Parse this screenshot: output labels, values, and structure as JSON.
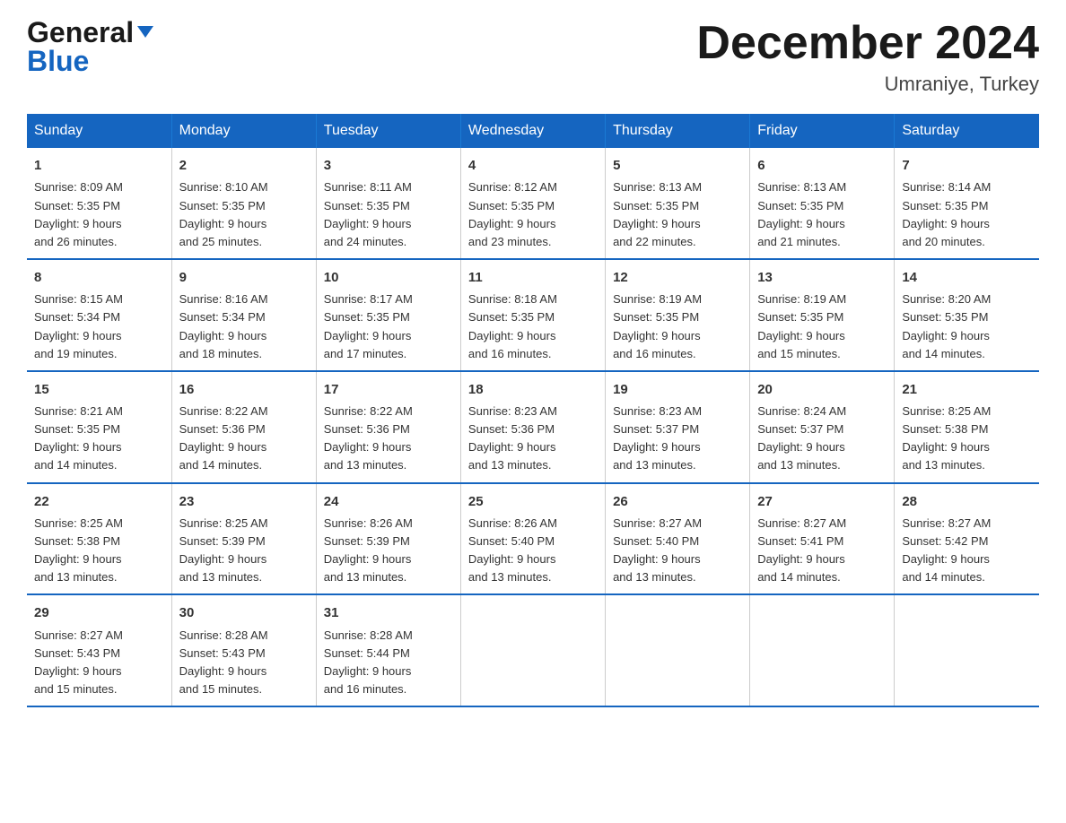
{
  "header": {
    "logo_line1": "General",
    "logo_line2": "Blue",
    "month_title": "December 2024",
    "location": "Umraniye, Turkey"
  },
  "days_of_week": [
    "Sunday",
    "Monday",
    "Tuesday",
    "Wednesday",
    "Thursday",
    "Friday",
    "Saturday"
  ],
  "weeks": [
    [
      {
        "day": 1,
        "sunrise": "8:09 AM",
        "sunset": "5:35 PM",
        "daylight": "9 hours and 26 minutes."
      },
      {
        "day": 2,
        "sunrise": "8:10 AM",
        "sunset": "5:35 PM",
        "daylight": "9 hours and 25 minutes."
      },
      {
        "day": 3,
        "sunrise": "8:11 AM",
        "sunset": "5:35 PM",
        "daylight": "9 hours and 24 minutes."
      },
      {
        "day": 4,
        "sunrise": "8:12 AM",
        "sunset": "5:35 PM",
        "daylight": "9 hours and 23 minutes."
      },
      {
        "day": 5,
        "sunrise": "8:13 AM",
        "sunset": "5:35 PM",
        "daylight": "9 hours and 22 minutes."
      },
      {
        "day": 6,
        "sunrise": "8:13 AM",
        "sunset": "5:35 PM",
        "daylight": "9 hours and 21 minutes."
      },
      {
        "day": 7,
        "sunrise": "8:14 AM",
        "sunset": "5:35 PM",
        "daylight": "9 hours and 20 minutes."
      }
    ],
    [
      {
        "day": 8,
        "sunrise": "8:15 AM",
        "sunset": "5:34 PM",
        "daylight": "9 hours and 19 minutes."
      },
      {
        "day": 9,
        "sunrise": "8:16 AM",
        "sunset": "5:34 PM",
        "daylight": "9 hours and 18 minutes."
      },
      {
        "day": 10,
        "sunrise": "8:17 AM",
        "sunset": "5:35 PM",
        "daylight": "9 hours and 17 minutes."
      },
      {
        "day": 11,
        "sunrise": "8:18 AM",
        "sunset": "5:35 PM",
        "daylight": "9 hours and 16 minutes."
      },
      {
        "day": 12,
        "sunrise": "8:19 AM",
        "sunset": "5:35 PM",
        "daylight": "9 hours and 16 minutes."
      },
      {
        "day": 13,
        "sunrise": "8:19 AM",
        "sunset": "5:35 PM",
        "daylight": "9 hours and 15 minutes."
      },
      {
        "day": 14,
        "sunrise": "8:20 AM",
        "sunset": "5:35 PM",
        "daylight": "9 hours and 14 minutes."
      }
    ],
    [
      {
        "day": 15,
        "sunrise": "8:21 AM",
        "sunset": "5:35 PM",
        "daylight": "9 hours and 14 minutes."
      },
      {
        "day": 16,
        "sunrise": "8:22 AM",
        "sunset": "5:36 PM",
        "daylight": "9 hours and 14 minutes."
      },
      {
        "day": 17,
        "sunrise": "8:22 AM",
        "sunset": "5:36 PM",
        "daylight": "9 hours and 13 minutes."
      },
      {
        "day": 18,
        "sunrise": "8:23 AM",
        "sunset": "5:36 PM",
        "daylight": "9 hours and 13 minutes."
      },
      {
        "day": 19,
        "sunrise": "8:23 AM",
        "sunset": "5:37 PM",
        "daylight": "9 hours and 13 minutes."
      },
      {
        "day": 20,
        "sunrise": "8:24 AM",
        "sunset": "5:37 PM",
        "daylight": "9 hours and 13 minutes."
      },
      {
        "day": 21,
        "sunrise": "8:25 AM",
        "sunset": "5:38 PM",
        "daylight": "9 hours and 13 minutes."
      }
    ],
    [
      {
        "day": 22,
        "sunrise": "8:25 AM",
        "sunset": "5:38 PM",
        "daylight": "9 hours and 13 minutes."
      },
      {
        "day": 23,
        "sunrise": "8:25 AM",
        "sunset": "5:39 PM",
        "daylight": "9 hours and 13 minutes."
      },
      {
        "day": 24,
        "sunrise": "8:26 AM",
        "sunset": "5:39 PM",
        "daylight": "9 hours and 13 minutes."
      },
      {
        "day": 25,
        "sunrise": "8:26 AM",
        "sunset": "5:40 PM",
        "daylight": "9 hours and 13 minutes."
      },
      {
        "day": 26,
        "sunrise": "8:27 AM",
        "sunset": "5:40 PM",
        "daylight": "9 hours and 13 minutes."
      },
      {
        "day": 27,
        "sunrise": "8:27 AM",
        "sunset": "5:41 PM",
        "daylight": "9 hours and 14 minutes."
      },
      {
        "day": 28,
        "sunrise": "8:27 AM",
        "sunset": "5:42 PM",
        "daylight": "9 hours and 14 minutes."
      }
    ],
    [
      {
        "day": 29,
        "sunrise": "8:27 AM",
        "sunset": "5:43 PM",
        "daylight": "9 hours and 15 minutes."
      },
      {
        "day": 30,
        "sunrise": "8:28 AM",
        "sunset": "5:43 PM",
        "daylight": "9 hours and 15 minutes."
      },
      {
        "day": 31,
        "sunrise": "8:28 AM",
        "sunset": "5:44 PM",
        "daylight": "9 hours and 16 minutes."
      },
      null,
      null,
      null,
      null
    ]
  ],
  "labels": {
    "sunrise_prefix": "Sunrise: ",
    "sunset_prefix": "Sunset: ",
    "daylight_prefix": "Daylight: "
  }
}
